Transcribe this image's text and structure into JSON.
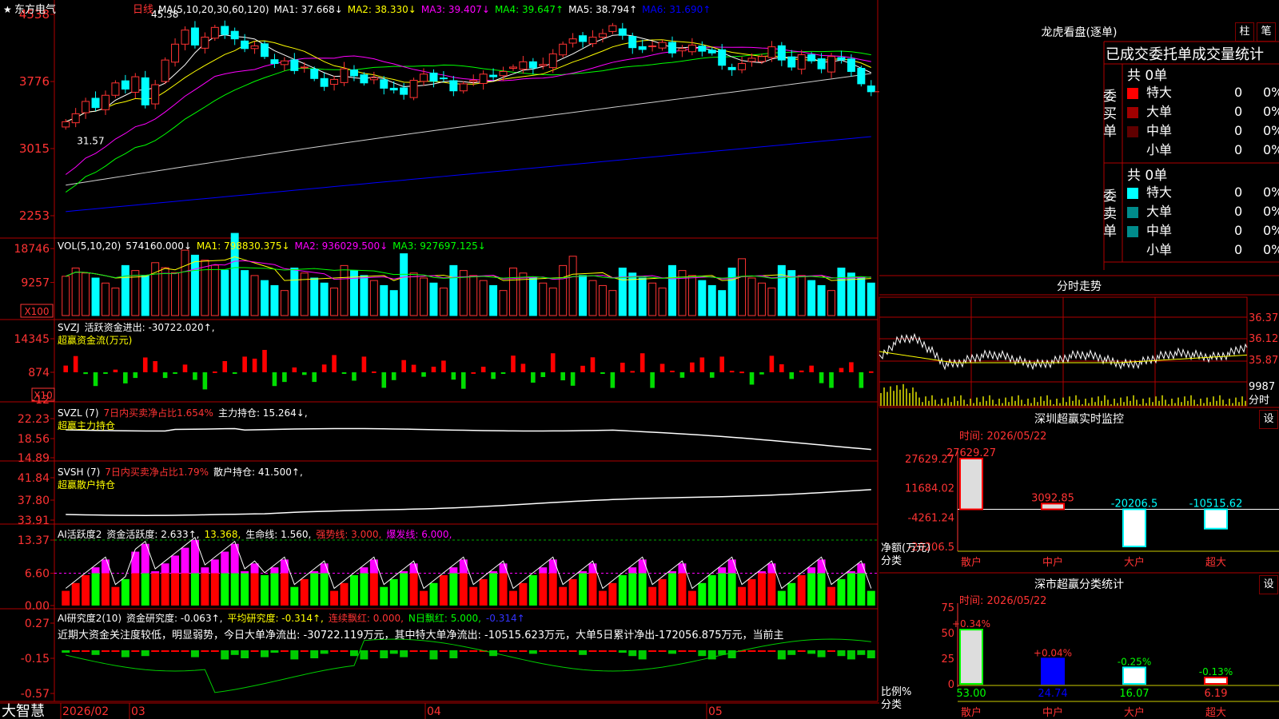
{
  "stock": {
    "name": "东方电气",
    "period": "日线"
  },
  "ma_legend": [
    {
      "text": "MA(5,10,20,30,60,120)",
      "color": "#ffffff"
    },
    {
      "text": "MA1: 37.668↓",
      "color": "#ffffff"
    },
    {
      "text": "MA2: 38.330↓",
      "color": "#ffff00"
    },
    {
      "text": "MA3: 39.407↓",
      "color": "#ff00ff"
    },
    {
      "text": "MA4: 39.647↑",
      "color": "#00ff00"
    },
    {
      "text": "MA5: 38.794↑",
      "color": "#ffffff"
    },
    {
      "text": "MA6: 31.690↑",
      "color": "#0000ff"
    }
  ],
  "price_axis": [
    "4538",
    "3776",
    "3015",
    "2253"
  ],
  "price_marks": {
    "high": "45.38",
    "low": "31.57"
  },
  "vol_legend": [
    {
      "text": "VOL(5,10,20)",
      "color": "#ffffff"
    },
    {
      "text": "574160.000↓",
      "color": "#ffffff"
    },
    {
      "text": "MA1: 798830.375↓",
      "color": "#ffff00"
    },
    {
      "text": "MA2: 936029.500↓",
      "color": "#ff00ff"
    },
    {
      "text": "MA3: 927697.125↓",
      "color": "#00ff00"
    }
  ],
  "vol_axis": [
    "18746",
    "9257"
  ],
  "vol_unit": "X100",
  "svzj_legend": [
    {
      "text": "SVZJ",
      "color": "#ffffff"
    },
    {
      "text": "活跃资金进出: -30722.020↑,",
      "color": "#ffffff"
    }
  ],
  "svzj_sub": "超赢资金流(万元)",
  "svzj_axis": [
    "14345",
    "874",
    "-12"
  ],
  "svzj_unit": "X10",
  "svzl_legend": [
    {
      "text": "SVZL (7)",
      "color": "#ffffff"
    },
    {
      "text": "7日内买卖净占比1.654%",
      "color": "#ff3333"
    },
    {
      "text": "主力持仓: 15.264↓,",
      "color": "#ffffff"
    }
  ],
  "svzl_sub": "超赢主力持仓",
  "svzl_axis": [
    "22.23",
    "18.56",
    "14.89"
  ],
  "svsh_legend": [
    {
      "text": "SVSH (7)",
      "color": "#ffffff"
    },
    {
      "text": "7日内买卖净占比1.79%",
      "color": "#ff3333"
    },
    {
      "text": "散户持仓: 41.500↑,",
      "color": "#ffffff"
    }
  ],
  "svsh_sub": "超赢散户持仓",
  "svsh_axis": [
    "41.84",
    "37.80",
    "33.91"
  ],
  "ai_legend": [
    {
      "text": "AI活跃度2",
      "color": "#ffffff"
    },
    {
      "text": "资金活跃度: 2.633↑,",
      "color": "#ffffff"
    },
    {
      "text": "13.368,",
      "color": "#ffff00"
    },
    {
      "text": "生命线: 1.560,",
      "color": "#ffffff"
    },
    {
      "text": "强势线: 3.000,",
      "color": "#ff3333"
    },
    {
      "text": "爆发线: 6.000,",
      "color": "#ff00ff"
    }
  ],
  "ai_axis": [
    "13.37",
    "6.60",
    "0.00"
  ],
  "ai2_legend": [
    {
      "text": "AI研究度2(10)",
      "color": "#ffffff"
    },
    {
      "text": "资金研究度: -0.063↑,",
      "color": "#ffffff"
    },
    {
      "text": "平均研究度: -0.314↑,",
      "color": "#ffff00"
    },
    {
      "text": "连续飘红: 0.000,",
      "color": "#ff3333"
    },
    {
      "text": "N日飘红: 5.000,",
      "color": "#00ff00"
    },
    {
      "text": "-0.314↑",
      "color": "#3333ff"
    }
  ],
  "ai2_text": "近期大资金关注度较低，明显弱势，今日大单净流出: -30722.119万元，其中特大单净流出: -10515.623万元，大单5日累计净出-172056.875万元，当前主",
  "ai2_axis": [
    "0.27",
    "-0.15",
    "-0.57"
  ],
  "bottom": {
    "brand": "大智慧",
    "date_start": "2026/02",
    "m1": "03",
    "m2": "04",
    "m3": "05"
  },
  "lhb": {
    "title": "龙虎看盘(逐单)",
    "btn1": "柱",
    "btn2": "笔",
    "header": "已成交委托单成交量统计",
    "buy_label": "委买单",
    "sell_label": "委卖单",
    "buy_total": "共 0单",
    "sell_total": "共 0单",
    "buy_rows": [
      {
        "name": "特大",
        "v": "0",
        "p": "0%",
        "color": "#ff0000"
      },
      {
        "name": "大单",
        "v": "0",
        "p": "0%",
        "color": "#a00000"
      },
      {
        "name": "中单",
        "v": "0",
        "p": "0%",
        "color": "#600000"
      },
      {
        "name": "小单",
        "v": "0",
        "p": "0%",
        "color": ""
      }
    ],
    "sell_rows": [
      {
        "name": "特大",
        "v": "0",
        "p": "0%",
        "color": "#00ffff"
      },
      {
        "name": "大单",
        "v": "0",
        "p": "0%",
        "color": "#008b8b"
      },
      {
        "name": "中单",
        "v": "0",
        "p": "0%",
        "color": "#008b8b"
      },
      {
        "name": "小单",
        "v": "0",
        "p": "0%",
        "color": ""
      }
    ]
  },
  "intraday": {
    "title": "分时走势",
    "axis": [
      "36.37",
      "36.12",
      "35.87",
      "9987"
    ],
    "unit": "分时"
  },
  "sz_monitor": {
    "title": "深圳超赢实时监控",
    "btn": "设",
    "time": "时间: 2026/05/22",
    "axis": [
      "27629.27",
      "11684.02",
      "-4261.24",
      "-20206.5"
    ],
    "ylabel": "净额(万元)",
    "xlabel": "分类",
    "cats": [
      "散户",
      "中户",
      "大户",
      "超大"
    ],
    "vals": [
      27629.27,
      3092.85,
      -20206.5,
      -10515.62
    ],
    "labels": [
      "27629.27",
      "3092.85",
      "-20206.5",
      "-10515.62"
    ]
  },
  "class_stats": {
    "title": "深市超赢分类统计",
    "btn": "设",
    "time": "时间: 2026/05/22",
    "axis": [
      "75",
      "50",
      "25",
      "0"
    ],
    "ylabel": "比例%",
    "xlabel": "分类",
    "cats": [
      "散户",
      "中户",
      "大户",
      "超大"
    ],
    "vals": [
      53.0,
      24.74,
      16.07,
      6.19
    ],
    "vlabels": [
      "53.00",
      "24.74",
      "16.07",
      "6.19"
    ],
    "changes": [
      "+0.34%",
      "+0.04%",
      "-0.25%",
      "-0.13%"
    ]
  },
  "chart_data": {
    "type": "candlestick",
    "closes": [
      33.2,
      34.1,
      35.5,
      34.8,
      36.2,
      37.6,
      36.9,
      38.3,
      35.1,
      37.4,
      40.2,
      42.0,
      43.6,
      41.9,
      42.8,
      43.9,
      43.1,
      42.6,
      41.5,
      41.8,
      40.6,
      39.8,
      40.1,
      39.0,
      39.4,
      38.1,
      37.2,
      38.0,
      39.2,
      38.4,
      37.6,
      38.2,
      37.0,
      36.8,
      36.3,
      37.9,
      38.6,
      37.8,
      38.1,
      36.7,
      37.5,
      37.9,
      38.6,
      38.3,
      38.9,
      39.4,
      40.0,
      39.3,
      39.7,
      40.9,
      42.0,
      42.6,
      42.3,
      42.8,
      43.2,
      44.1,
      43.0,
      41.6,
      41.4,
      41.8,
      42.2,
      41.0,
      41.5,
      41.9,
      41.2,
      41.0,
      39.6,
      39.1,
      39.8,
      40.4,
      40.6,
      41.7,
      40.2,
      39.4,
      40.8,
      40.1,
      39.2,
      40.6,
      40.2,
      38.9,
      37.5,
      36.6
    ]
  }
}
